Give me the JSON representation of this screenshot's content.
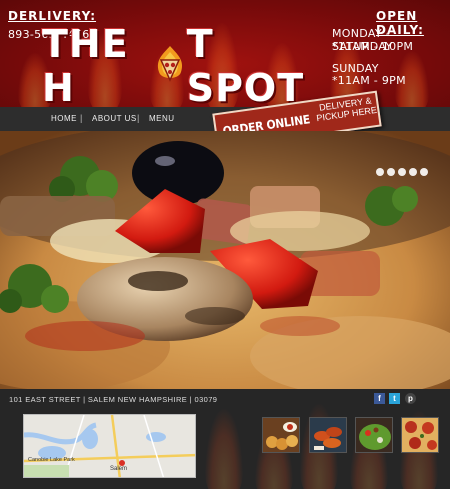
{
  "header": {
    "delivery_label": "DERLIVERY:",
    "phone": "893-563-4456",
    "open_label": "OPEN DAILY:",
    "weekday_days": "MONDAY - SATURDAY",
    "weekday_hours": "*11AM - 10PM",
    "sunday_days": "SUNDAY",
    "sunday_hours": "*11AM -  9PM",
    "logo_left": "THE H",
    "logo_right": "T SPOT"
  },
  "nav": {
    "items": [
      {
        "label": "HOME"
      },
      {
        "label": "ABOUT US"
      },
      {
        "label": "MENU"
      }
    ],
    "separator": "|"
  },
  "order": {
    "main_label": "ORDER ONLINE",
    "sub_label_1": "DELIVERY &",
    "sub_label_2": "PICKUP HERE"
  },
  "hero": {
    "slide_count": 5,
    "active_slide": 1
  },
  "footer": {
    "address": "101 EAST STREET | SALEM NEW HAMPSHIRE | 03079",
    "social": [
      {
        "icon": "facebook-icon",
        "glyph": "f",
        "color": "#3b5998"
      },
      {
        "icon": "twitter-icon",
        "glyph": "t",
        "color": "#2aa4d9"
      },
      {
        "icon": "pinterest-icon",
        "glyph": "p",
        "color": "#444444"
      }
    ],
    "map": {
      "place_1": "Canobie Lake Park",
      "place_2": "Salem"
    },
    "thumbnails": [
      "fried-food-thumbnail",
      "wings-thumbnail",
      "salad-thumbnail",
      "pepperoni-thumbnail"
    ]
  },
  "colors": {
    "header_red": "#8b0c0c",
    "nav_bg": "#2d2d2d",
    "order_badge": "#a0281a",
    "footer_bg": "#262626"
  }
}
